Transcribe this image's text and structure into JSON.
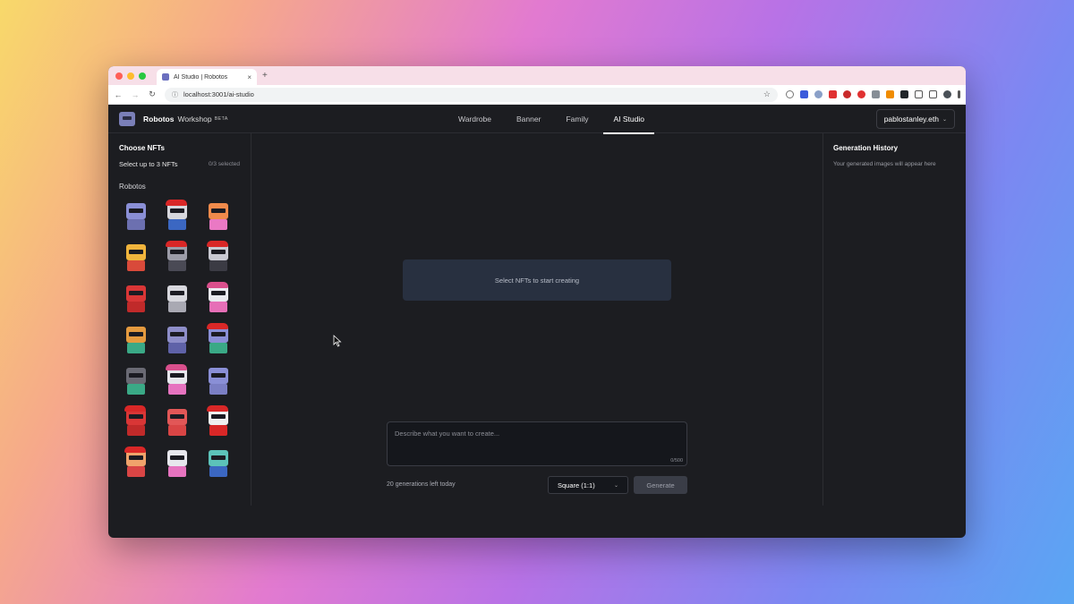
{
  "browser": {
    "tab_title": "AI Studio | Robotos",
    "tab_close": "×",
    "new_tab": "+",
    "url": "localhost:3001/ai-studio"
  },
  "header": {
    "brand": "Robotos",
    "brand_sub": "Workshop",
    "badge": "BETA",
    "nav": [
      "Wardrobe",
      "Banner",
      "Family",
      "AI Studio"
    ],
    "active_nav": "AI Studio",
    "account": "pablostanley.eth"
  },
  "left_panel": {
    "title": "Choose NFTs",
    "hint": "Select up to 3 NFTs",
    "selected_count": "0/3 selected",
    "collection": "Robotos",
    "nfts": [
      {
        "head": "#8a8fd6",
        "body": "#6c70b0",
        "hair": ""
      },
      {
        "head": "#d7d7dd",
        "body": "#3b67c2",
        "hair": "#d92727"
      },
      {
        "head": "#f08a4b",
        "body": "#ea79c4",
        "hair": ""
      },
      {
        "head": "#f0b43c",
        "body": "#d94a3a",
        "hair": ""
      },
      {
        "head": "#9c9ca8",
        "body": "#4a4a55",
        "hair": "#d92727"
      },
      {
        "head": "#c9c9d2",
        "body": "#3b3b44",
        "hair": "#d92727"
      },
      {
        "head": "#d93636",
        "body": "#c02a2a",
        "hair": ""
      },
      {
        "head": "#d8d8de",
        "body": "#a9a9b3",
        "hair": ""
      },
      {
        "head": "#e9e9ef",
        "body": "#e66fb7",
        "hair": "#d94f8c"
      },
      {
        "head": "#e49a3f",
        "body": "#3aa986",
        "hair": ""
      },
      {
        "head": "#8e8ec9",
        "body": "#5f62a8",
        "hair": ""
      },
      {
        "head": "#8a8fd6",
        "body": "#3aa986",
        "hair": "#d92727"
      },
      {
        "head": "#6a6a74",
        "body": "#3aa986",
        "hair": ""
      },
      {
        "head": "#e7e7ed",
        "body": "#e673bf",
        "hair": "#d94f8c"
      },
      {
        "head": "#8a8fd6",
        "body": "#7b7fc4",
        "hair": ""
      },
      {
        "head": "#d93636",
        "body": "#c02a2a",
        "hair": "#d92727"
      },
      {
        "head": "#e25757",
        "body": "#d94545",
        "hair": ""
      },
      {
        "head": "#efefef",
        "body": "#d92727",
        "hair": "#d92727"
      },
      {
        "head": "#f0a36b",
        "body": "#d94545",
        "hair": "#d92727"
      },
      {
        "head": "#e7e7ed",
        "body": "#e673bf",
        "hair": ""
      },
      {
        "head": "#5cc2b9",
        "body": "#3b67c2",
        "hair": ""
      }
    ]
  },
  "center": {
    "placeholder": "Select NFTs to start creating",
    "prompt_placeholder": "Describe what you want to create...",
    "prompt_counter": "0/500",
    "generations_left": "20 generations left today",
    "aspect_ratio": "Square (1:1)",
    "generate_label": "Generate"
  },
  "right_panel": {
    "title": "Generation History",
    "empty": "Your generated images will appear here"
  }
}
